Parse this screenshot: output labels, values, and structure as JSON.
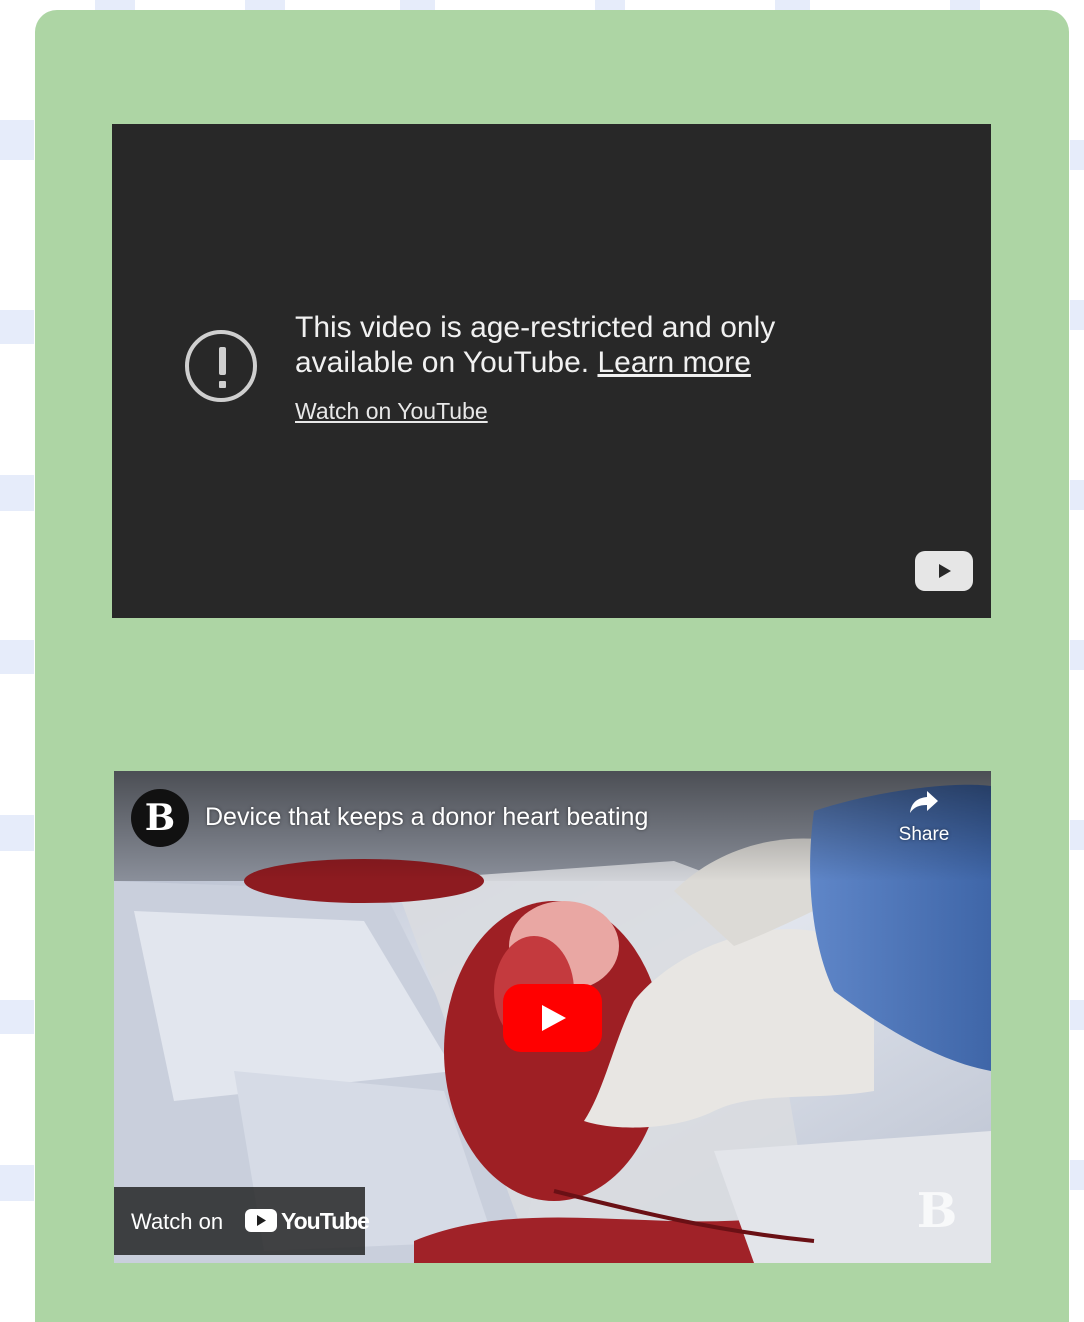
{
  "embed_restricted": {
    "message_line1": "This video is age-restricted and only",
    "message_line2": "available on YouTube.",
    "learn_more": "Learn more",
    "watch_link": "Watch on YouTube"
  },
  "embed_video": {
    "channel_logo": "B",
    "title": "Device that keeps a donor heart beating",
    "share_label": "Share",
    "watch_on_label": "Watch on",
    "youtube_wordmark": "YouTube",
    "watermark": "B"
  },
  "colors": {
    "panel_green": "#add5a4",
    "player_bg": "#282828",
    "youtube_red": "#ff0000"
  }
}
